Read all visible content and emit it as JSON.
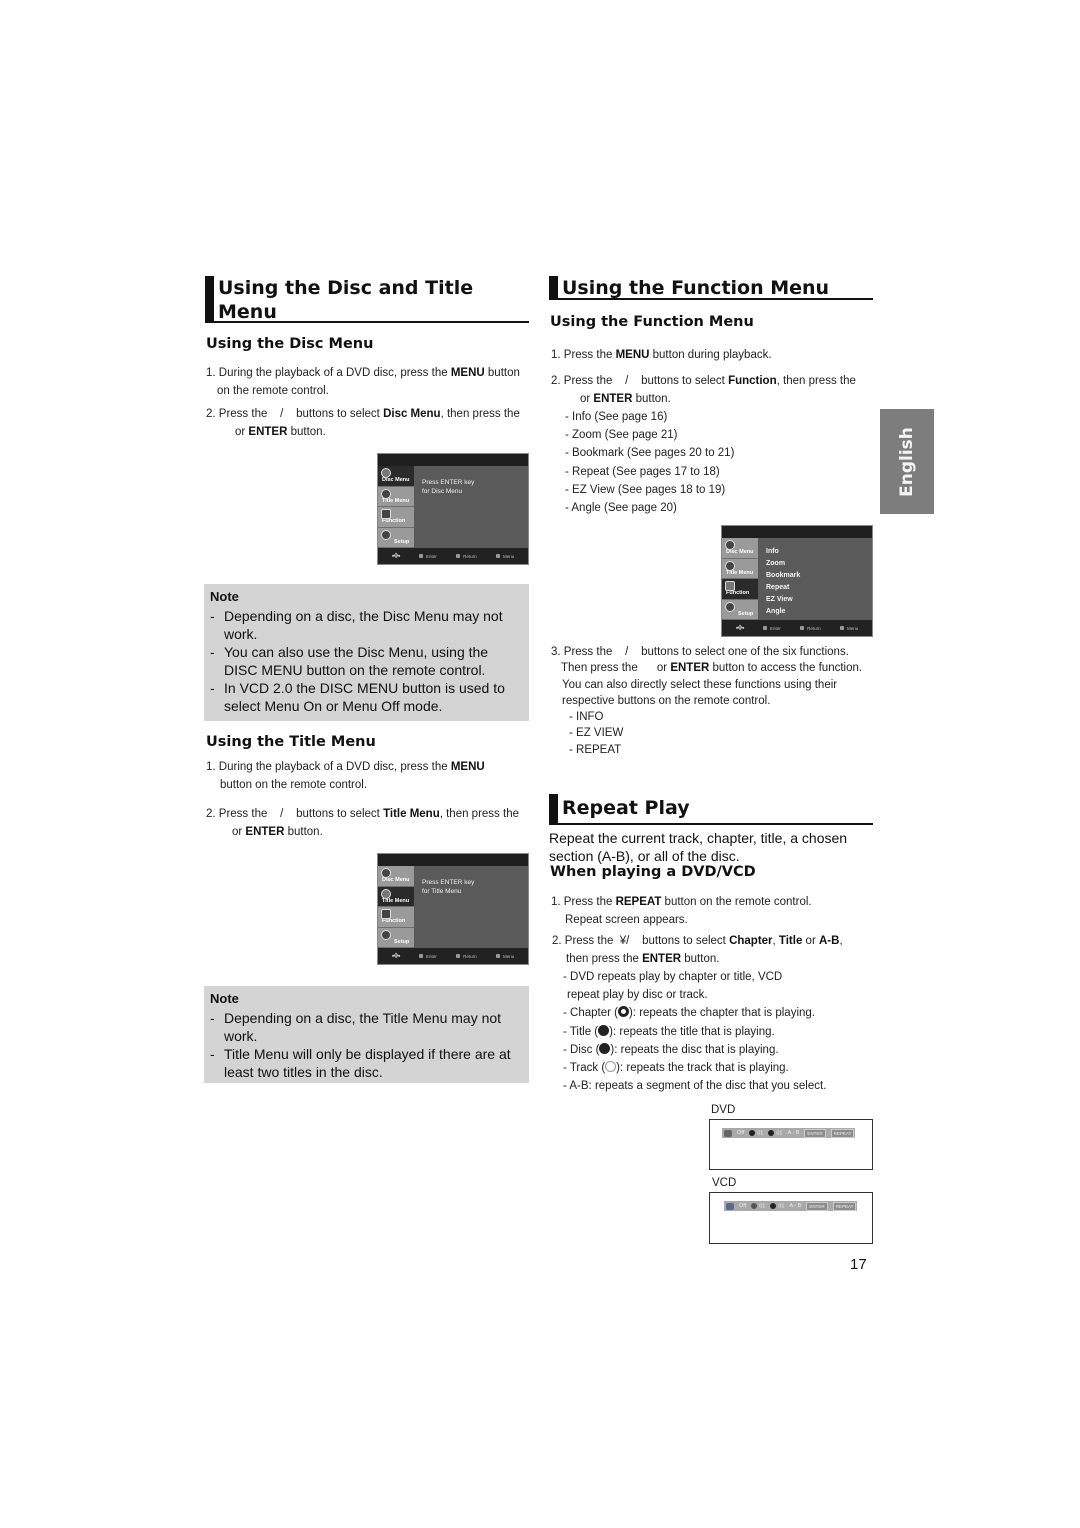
{
  "left": {
    "section_title_line1": "Using the Disc and Title",
    "section_title_line2": "Menu",
    "disc_menu": {
      "heading": "Using the Disc Menu",
      "step1_a": "1. During the playback of a DVD disc, press the ",
      "step1_bold": "MENU",
      "step1_b": " button",
      "step1_c": "on the remote control.",
      "step2_a": "2. Press the    /    buttons to select ",
      "step2_bold": "Disc Menu",
      "step2_b": ", then press the",
      "step2_c": "or ",
      "step2_bold2": "ENTER",
      "step2_d": " button.",
      "osd": {
        "tabs": [
          "Disc Menu",
          "Title Menu",
          "Function",
          "Setup"
        ],
        "active_tab": 0,
        "message_line1": "Press ENTER key",
        "message_line2": "for Disc Menu",
        "footer": [
          "Enter",
          "Return",
          "Menu"
        ]
      },
      "note": {
        "title": "Note",
        "items": [
          "Depending on a disc, the Disc Menu may not work.",
          "You can also use the Disc Menu, using the DISC MENU button on the remote control.",
          "In VCD 2.0 the DISC MENU button is used to select Menu On or Menu Off mode."
        ]
      }
    },
    "title_menu": {
      "heading": "Using the Title Menu",
      "step1_a": "1. During the playback of a DVD disc, press the ",
      "step1_bold": "MENU",
      "step1_c": "button on the remote control.",
      "step2_a": "2. Press the    /    buttons to select ",
      "step2_bold": "Title Menu",
      "step2_b": ", then press the",
      "step2_c": "or ",
      "step2_bold2": "ENTER",
      "step2_d": " button.",
      "osd": {
        "tabs": [
          "Disc Menu",
          "Title Menu",
          "Function",
          "Setup"
        ],
        "active_tab": 1,
        "message_line1": "Press ENTER key",
        "message_line2": "for Title Menu",
        "footer": [
          "Enter",
          "Return",
          "Menu"
        ]
      },
      "note": {
        "title": "Note",
        "items": [
          "Depending on a disc, the Title Menu may not work.",
          "Title Menu will only be displayed if there are at least two titles in the disc."
        ]
      }
    }
  },
  "right": {
    "section_title": "Using the Function Menu",
    "function_menu": {
      "heading": "Using the Function Menu",
      "step1_a": "1. Press the ",
      "step1_bold": "MENU",
      "step1_b": " button during playback.",
      "step2_a": "2. Press the    /    buttons to select ",
      "step2_bold": "Function",
      "step2_b": ", then press the",
      "step2_c": "or ",
      "step2_bold2": "ENTER",
      "step2_d": " button.",
      "functions": [
        "Info (See page 16)",
        "Zoom (See page 21)",
        "Bookmark (See pages 20 to 21)",
        "Repeat (See pages 17 to 18)",
        "EZ View (See pages 18 to 19)",
        "Angle (See page 20)"
      ],
      "osd": {
        "tabs": [
          "Disc Menu",
          "Title Menu",
          "Function",
          "Setup"
        ],
        "active_tab": 2,
        "items": [
          "Info",
          "Zoom",
          "Bookmark",
          "Repeat",
          "EZ View",
          "Angle"
        ],
        "footer": [
          "Enter",
          "Return",
          "Menu"
        ]
      },
      "step3_line1": "3. Press the    /    buttons to select one of the six functions.",
      "step3_line2_a": "Then press the      or ",
      "step3_line2_bold": "ENTER",
      "step3_line2_b": " button to access the function.",
      "step3_line3": "You can also directly select these functions using their",
      "step3_line4": "respective buttons on the remote control.",
      "direct_buttons": [
        "INFO",
        "EZ VIEW",
        "REPEAT"
      ]
    },
    "repeat_play": {
      "section_title": "Repeat Play",
      "intro_line1": "Repeat the current track, chapter, title, a chosen",
      "intro_line2": "section (A-B), or all of the disc.",
      "heading": "When playing a DVD/VCD",
      "step1_a": "1. Press the ",
      "step1_bold": "REPEAT",
      "step1_b": " button on the remote control.",
      "step1_c": "Repeat screen appears.",
      "step2_a": "2. Press the  ¥/    buttons to select ",
      "step2_bold1": "Chapter",
      "step2_sep1": ", ",
      "step2_bold2": "Title",
      "step2_sep2": " or ",
      "step2_bold3": "A-B",
      "step2_end": ",",
      "step2_c": "then press the ",
      "step2_bold4": "ENTER",
      "step2_d": " button.",
      "details": {
        "line1": "- DVD repeats play by chapter or title, VCD",
        "line2": "repeat play by disc or track.",
        "chapter_a": "- Chapter (",
        "chapter_b": "): repeats the chapter that is playing.",
        "title_a": "- Title (",
        "title_b": "): repeats the title that is playing.",
        "disc_a": "- Disc (",
        "disc_b": "): repeats the disc that is playing.",
        "track_a": "- Track (",
        "track_b": "): repeats the track that is playing.",
        "ab": "- A-B: repeats a segment of the disc that you select."
      },
      "dvd_bar": {
        "label": "DVD",
        "mode": "Off",
        "chapter": "01",
        "title": "01",
        "ab": "A - B",
        "btn1": "ENTER",
        "btn2": "REPEAT"
      },
      "vcd_bar": {
        "label": "VCD",
        "mode": "Off",
        "disc": "01",
        "track": "01",
        "ab": "A - B",
        "btn1": "ENTER",
        "btn2": "REPEAT"
      }
    }
  },
  "language_tab": "English",
  "page_number": "17"
}
